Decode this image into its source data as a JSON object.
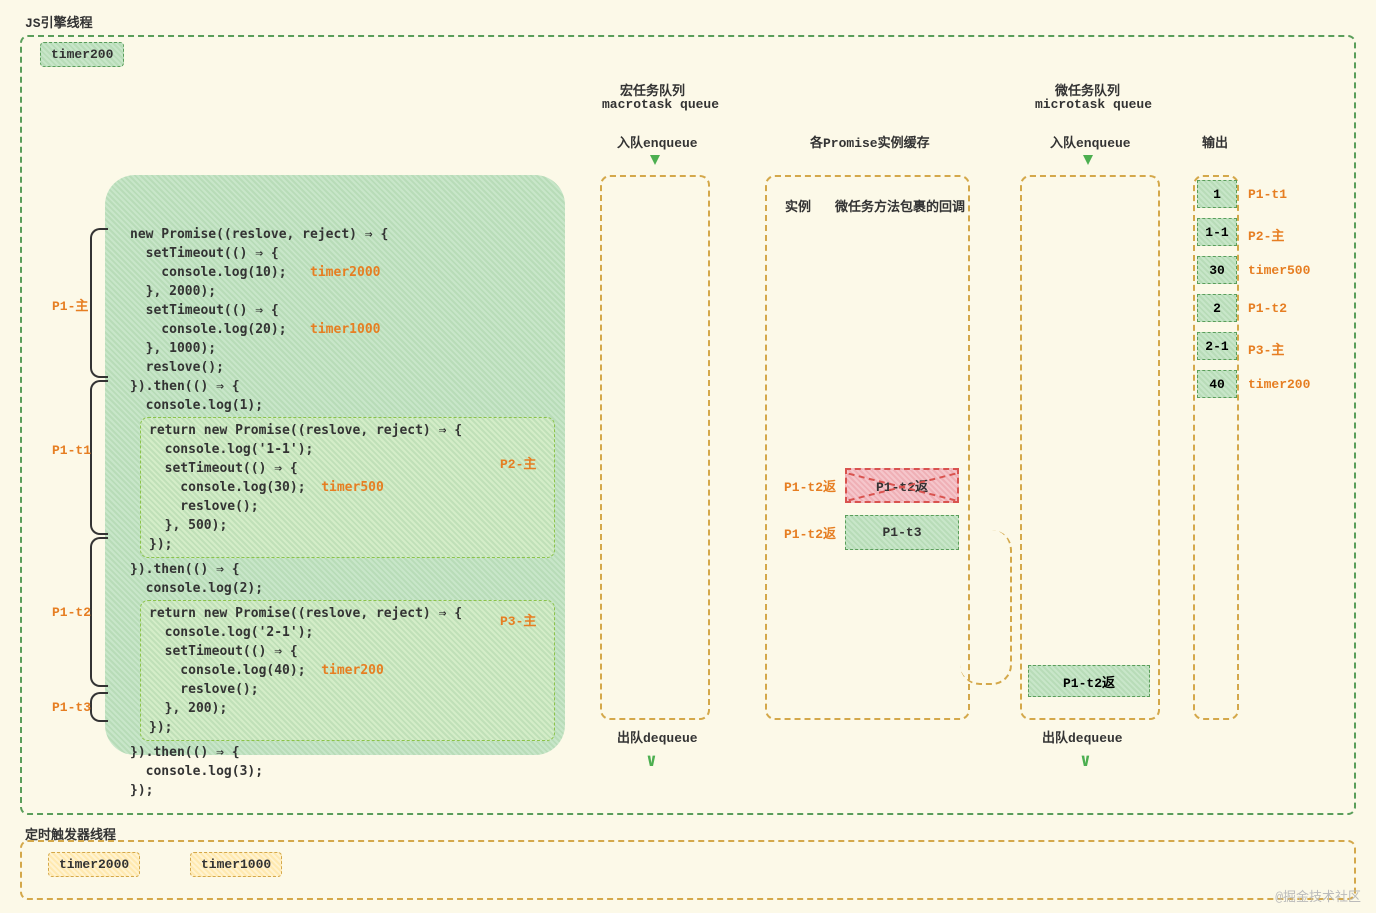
{
  "js_engine_label": "JS引擎线程",
  "timer_thread_label": "定时触发器线程",
  "timer200_badge": "timer200",
  "timer_bottom": [
    "timer2000",
    "timer1000"
  ],
  "code": {
    "line1": "new Promise((reslove, reject) ⇒ {",
    "line2": "  setTimeout(() ⇒ {",
    "line3": "    console.log(10);",
    "line3_timer": "timer2000",
    "line4": "  }, 2000);",
    "line5": "  setTimeout(() ⇒ {",
    "line6": "    console.log(20);",
    "line6_timer": "timer1000",
    "line7": "  }, 1000);",
    "line8": "  reslove();",
    "line9": "}).then(() ⇒ {",
    "line10": "  console.log(1);",
    "inner1": {
      "l1": "return new Promise((reslove, reject) ⇒ {",
      "l2": "  console.log('1-1');",
      "l3": "  setTimeout(() ⇒ {",
      "l4": "    console.log(30);",
      "l4_timer": "timer500",
      "l5": "    reslove();",
      "l6": "  }, 500);",
      "l7": "});",
      "label": "P2-主"
    },
    "line11": "}).then(() ⇒ {",
    "line12": "  console.log(2);",
    "inner2": {
      "l1": "return new Promise((reslove, reject) ⇒ {",
      "l2": "  console.log('2-1');",
      "l3": "  setTimeout(() ⇒ {",
      "l4": "    console.log(40);",
      "l4_timer": "timer200",
      "l5": "    reslove();",
      "l6": "  }, 200);",
      "l7": "});",
      "label": "P3-主"
    },
    "line13": "}).then(() ⇒ {",
    "line14": "  console.log(3);",
    "line15": "});"
  },
  "code_labels": {
    "p1_main": "P1-主",
    "p1_t1": "P1-t1",
    "p1_t2": "P1-t2",
    "p1_t3": "P1-t3"
  },
  "columns": {
    "macrotask_title": "宏任务队列",
    "macrotask_sub": "macrotask queue",
    "microtask_title": "微任务队列",
    "microtask_sub": "microtask queue",
    "promise_title": "各Promise实例缓存",
    "output_title": "输出",
    "enqueue": "入队enqueue",
    "dequeue": "出队dequeue",
    "promise_col1": "实例",
    "promise_col2": "微任务方法包裹的回调"
  },
  "promise_cache": [
    {
      "left": "P1-t2返",
      "right": "P1-t2返",
      "crossed": true
    },
    {
      "left": "P1-t2返",
      "right": "P1-t3",
      "crossed": false
    }
  ],
  "microtask_items": [
    {
      "label": "P1-t2返"
    }
  ],
  "output": [
    {
      "value": "1",
      "label": "P1-t1"
    },
    {
      "value": "1-1",
      "label": "P2-主"
    },
    {
      "value": "30",
      "label": "timer500"
    },
    {
      "value": "2",
      "label": "P1-t2"
    },
    {
      "value": "2-1",
      "label": "P3-主"
    },
    {
      "value": "40",
      "label": "timer200"
    }
  ],
  "watermark": "@掘金技术社区"
}
